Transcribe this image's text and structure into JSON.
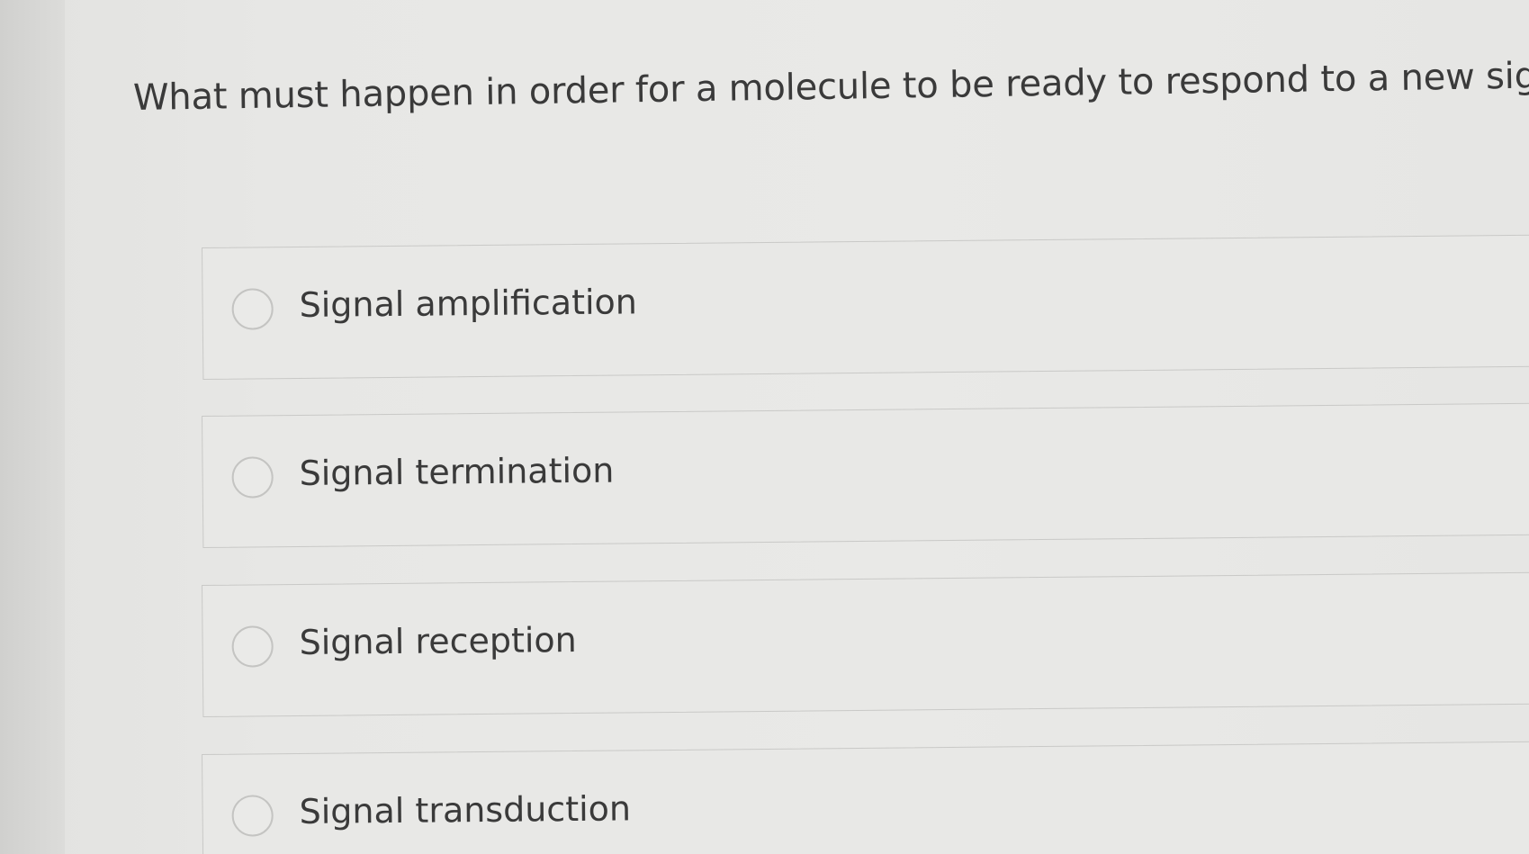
{
  "question": {
    "text": "What must happen in order for a molecule to be ready to respond to a new signal?"
  },
  "options": [
    {
      "label": "Signal amplification",
      "selected": false
    },
    {
      "label": "Signal termination",
      "selected": false
    },
    {
      "label": "Signal reception",
      "selected": false
    },
    {
      "label": "Signal transduction",
      "selected": false
    }
  ]
}
